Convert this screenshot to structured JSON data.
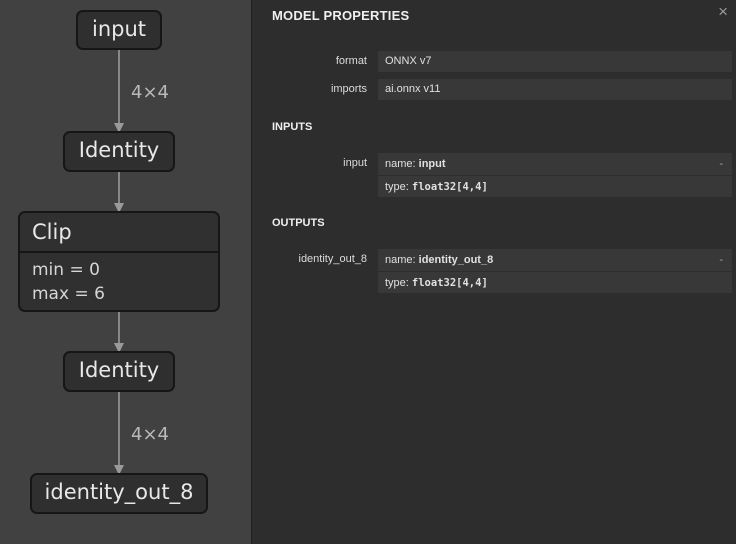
{
  "graph": {
    "nodes": {
      "input": "input",
      "identity_1": "Identity",
      "clip": "Clip",
      "clip_min": "min = 0",
      "clip_max": "max = 6",
      "identity_2": "Identity",
      "output": "identity_out_8"
    },
    "edge_labels": {
      "input_to_identity": "4×4",
      "identity_to_output": "4×4"
    }
  },
  "sidebar": {
    "title": "MODEL PROPERTIES",
    "close_icon": "×",
    "properties": [
      {
        "label": "format",
        "value": "ONNX v7"
      },
      {
        "label": "imports",
        "value": "ai.onnx v11"
      }
    ],
    "inputs": {
      "title": "INPUTS",
      "items": [
        {
          "label": "input",
          "name_prefix": "name: ",
          "name": "input",
          "type_prefix": "type: ",
          "type": "float32[4,4]",
          "expand": "-"
        }
      ]
    },
    "outputs": {
      "title": "OUTPUTS",
      "items": [
        {
          "label": "identity_out_8",
          "name_prefix": "name: ",
          "name": "identity_out_8",
          "type_prefix": "type: ",
          "type": "float32[4,4]",
          "expand": "-"
        }
      ]
    }
  }
}
